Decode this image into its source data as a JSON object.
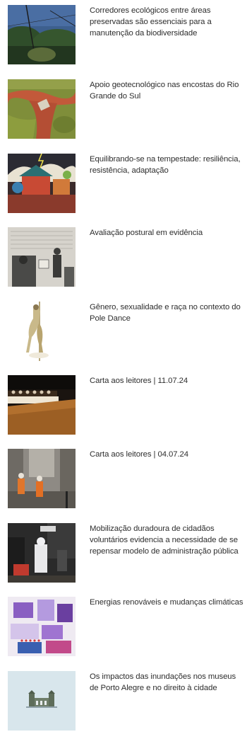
{
  "articles": [
    {
      "title": "Corredores ecológicos entre áreas preservadas são essenciais para a manutenção da biodiversidade",
      "image": "forest-landscape"
    },
    {
      "title": "Apoio geotecnológico nas encostas do Rio Grande do Sul",
      "image": "landslide-aerial"
    },
    {
      "title": "Equilibrando-se na tempestade: resiliência, resistência, adaptação",
      "image": "storm-illustration"
    },
    {
      "title": "Avaliação postural em evidência",
      "image": "vintage-collage"
    },
    {
      "title": "Gênero, sexualidade e raça no contexto do Pole Dance",
      "image": "pole-dance-illustration"
    },
    {
      "title": "Carta aos leitores | 11.07.24",
      "image": "auditorium-panel"
    },
    {
      "title": "Carta aos leitores | 04.07.24",
      "image": "flooded-street-workers"
    },
    {
      "title": "Mobilização duradoura de cidadãos voluntários evidencia a necessidade de se repensar modelo de administração pública",
      "image": "volunteer-protective-suit"
    },
    {
      "title": "Energias renováveis e mudanças climáticas",
      "image": "purple-collage"
    },
    {
      "title": "Os impactos das inundações nos museus de Porto Alegre e no direito à cidade",
      "image": "museum-building-icon"
    }
  ]
}
